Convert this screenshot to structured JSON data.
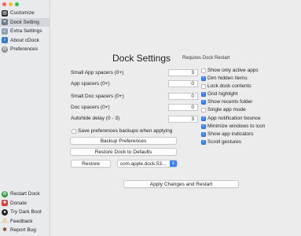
{
  "sidebar": {
    "items": [
      {
        "label": "Customize",
        "icon": "customize-icon",
        "selected": false
      },
      {
        "label": "Dock Setting",
        "icon": "tools-icon",
        "selected": true
      },
      {
        "label": "Extra Settings",
        "icon": "rocket-icon",
        "selected": false
      },
      {
        "label": "About cDock",
        "icon": "info-icon",
        "selected": false
      },
      {
        "label": "Preferences",
        "icon": "gear-icon",
        "selected": false
      }
    ],
    "bottom_items": [
      {
        "label": "Restart Dock",
        "icon": "recycle-icon"
      },
      {
        "label": "Donate",
        "icon": "gift-icon"
      },
      {
        "label": "Try Dark Boot",
        "icon": "dark-boot-icon"
      },
      {
        "label": "Feedback",
        "icon": "warning-icon"
      },
      {
        "label": "Report Bug",
        "icon": "bug-icon"
      }
    ]
  },
  "main": {
    "title": "Dock Settings",
    "subtitle": "Requires Dock Restart",
    "fields": [
      {
        "label": "Small App spacers (0+)",
        "value": "3"
      },
      {
        "label": "App spacers (0+)",
        "value": "0"
      },
      {
        "label": "Small Doc spacers (0+)",
        "value": "0"
      },
      {
        "label": "Doc spacers (0+)",
        "value": "0"
      },
      {
        "label": "Autohide delay (0 - 3)",
        "value": "3"
      }
    ],
    "save_backups_label": "Save preferences backups when applying",
    "save_backups_checked": false,
    "backup_button": "Backup Preferences",
    "restore_defaults_button": "Restore Dock to Defaults",
    "restore_button": "Restore",
    "restore_select_value": "com.apple.dock.53...",
    "apply_button": "Apply Changes and Restart",
    "options": [
      {
        "label": "Show only active apps",
        "checked": false
      },
      {
        "label": "Dim hidden Items",
        "checked": true
      },
      {
        "label": "Lock dock contents",
        "checked": false
      },
      {
        "label": "Grid highlight",
        "checked": true
      },
      {
        "label": "Show recents folder",
        "checked": true
      },
      {
        "label": "Single app mode",
        "checked": false
      },
      {
        "label": "App notification bounce",
        "checked": true
      },
      {
        "label": "Minimize windows to icon",
        "checked": true
      },
      {
        "label": "Show app indicators",
        "checked": true
      },
      {
        "label": "Scroll gestures",
        "checked": true
      }
    ]
  },
  "colors": {
    "accent": "#3b82f6",
    "close": "#fe5f57",
    "minimize": "#febc2e",
    "zoom": "#28c840",
    "sidebar_selected": "#d4d6dc"
  }
}
